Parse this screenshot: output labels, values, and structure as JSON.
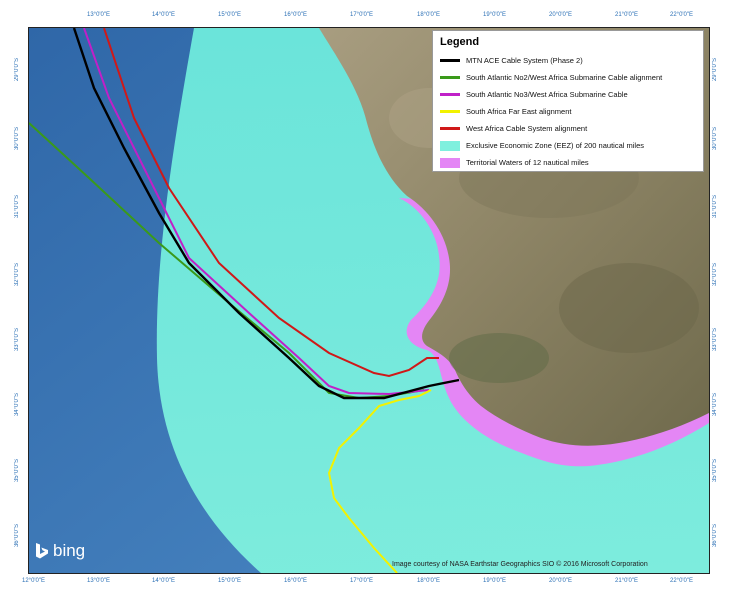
{
  "legend": {
    "title": "Legend",
    "items": [
      {
        "label": "MTN ACE Cable System (Phase 2)",
        "color": "#000000",
        "kind": "line",
        "icon": "line-swatch"
      },
      {
        "label": "South Atlantic No2/West Africa Submarine Cable alignment",
        "color": "#3a9a1a",
        "kind": "line",
        "icon": "line-swatch"
      },
      {
        "label": "South Atlantic No3/West Africa Submarine Cable",
        "color": "#c020c8",
        "kind": "line",
        "icon": "line-swatch"
      },
      {
        "label": "South Africa Far East alignment",
        "color": "#f2f200",
        "kind": "line",
        "icon": "line-swatch"
      },
      {
        "label": "West Africa Cable System alignment",
        "color": "#d01818",
        "kind": "line",
        "icon": "line-swatch"
      },
      {
        "label": "Exclusive Economic Zone (EEZ) of 200 nautical miles",
        "color": "#7ff0de",
        "kind": "area",
        "icon": "area-swatch"
      },
      {
        "label": "Territorial Waters of 12 nautical miles",
        "color": "#e486f5",
        "kind": "area",
        "icon": "area-swatch"
      }
    ]
  },
  "ticks": {
    "top": [
      "13°0'0\"E",
      "14°0'0\"E",
      "15°0'0\"E",
      "16°0'0\"E",
      "17°0'0\"E",
      "18°0'0\"E",
      "19°0'0\"E",
      "20°0'0\"E",
      "21°0'0\"E",
      "22°0'0\"E"
    ],
    "bottom": [
      "12°0'0\"E",
      "13°0'0\"E",
      "14°0'0\"E",
      "15°0'0\"E",
      "16°0'0\"E",
      "17°0'0\"E",
      "18°0'0\"E",
      "19°0'0\"E",
      "20°0'0\"E",
      "21°0'0\"E",
      "22°0'0\"E"
    ],
    "left": [
      "29°0'0\"S",
      "30°0'0\"S",
      "31°0'0\"S",
      "32°0'0\"S",
      "33°0'0\"S",
      "34°0'0\"S",
      "35°0'0\"S",
      "36°0'0\"S"
    ],
    "right": [
      "29°0'0\"S",
      "30°0'0\"S",
      "31°0'0\"S",
      "32°0'0\"S",
      "33°0'0\"S",
      "34°0'0\"S",
      "35°0'0\"S",
      "36°0'0\"S"
    ]
  },
  "credit": "Image courtesy of NASA Earthstar Geographics  SIO © 2016 Microsoft Corporation",
  "brand": {
    "name": "bing",
    "icon": "bing-logo-icon"
  },
  "colors": {
    "ocean": "#3f7fbe",
    "ocean_deep": "#2f67a8",
    "land": "#9a8f72",
    "land_dark": "#6f6a4c",
    "eez": "#7ff0de",
    "territorial": "#e486f5",
    "tick_text": "#2a6fb5"
  }
}
